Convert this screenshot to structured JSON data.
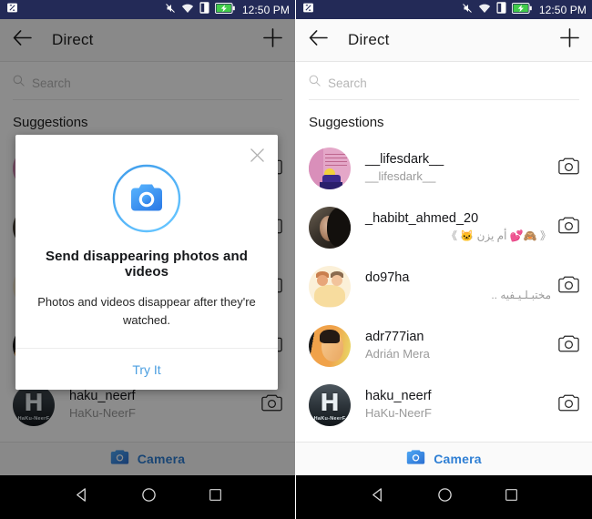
{
  "statusbar": {
    "time": "12:50 PM",
    "icons": [
      "nfc-icon",
      "vibrate-mute-icon",
      "wifi-icon",
      "dual-sim-icon",
      "battery-charging-icon"
    ],
    "background": "#232a57"
  },
  "appbar": {
    "back_label": "back-arrow",
    "title": "Direct",
    "new_message_label": "new-message-plus"
  },
  "search": {
    "placeholder": "Search",
    "value": ""
  },
  "section": {
    "suggestions_title": "Suggestions"
  },
  "suggestions": [
    {
      "username": "__lifesdark__",
      "fullname": "__lifesdark__",
      "rtl": false,
      "avatar": "avatar-lifesdark",
      "action": "camera-icon"
    },
    {
      "username": "_habibt_ahmed_20",
      "fullname": "《 🙈💕 أم يزن 🐱 》",
      "rtl": true,
      "avatar": "avatar-habibt-ahmed",
      "action": "camera-icon"
    },
    {
      "username": "do97ha",
      "fullname": "مختبـلـيـفيه ..",
      "rtl": true,
      "avatar": "avatar-do97ha",
      "action": "camera-icon"
    },
    {
      "username": "adr777ian",
      "fullname": "Adrián Mera",
      "rtl": false,
      "avatar": "avatar-adr777ian",
      "action": "camera-icon"
    },
    {
      "username": "haku_neerf",
      "fullname": "HaKu-NeerF",
      "rtl": false,
      "avatar": "avatar-haku-neerf",
      "action": "camera-icon"
    }
  ],
  "camerabar": {
    "label": "Camera",
    "color": "#2f7fd4"
  },
  "navbar": {
    "back": "nav-back-triangle",
    "home": "nav-home-circle",
    "recents": "nav-recents-square"
  },
  "dialog": {
    "visible_on": "left-screen",
    "close_label": "close-x",
    "icon": "camera-circle-icon",
    "heading": "Send disappearing photos and videos",
    "body": "Photos and videos disappear after they're watched.",
    "action_label": "Try It",
    "action_color": "#4a9ee0"
  },
  "avatar_art": {
    "avatar-haku-neerf": {
      "letter": "H",
      "caption": "HaKu-NeerF"
    }
  }
}
